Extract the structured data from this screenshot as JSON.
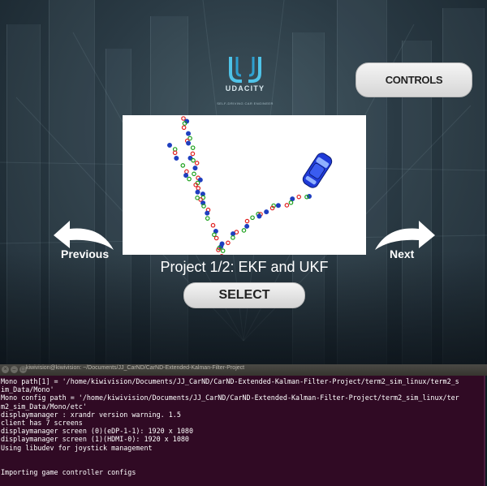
{
  "simulator": {
    "logo": {
      "wordmark": "UDACITY",
      "tagline": "SELF-DRIVING CAR ENGINEER",
      "icon": "udacity-u-logo"
    },
    "controls_label": "CONTROLS",
    "previous_label": "Previous",
    "next_label": "Next",
    "project_title": "Project 1/2: EKF and UKF",
    "select_label": "SELECT",
    "preview": {
      "icon": "car-icon",
      "marker_colors": {
        "lidar": "#e02020",
        "radar": "#1f3fbf",
        "estimate": "#1aa01a"
      },
      "car_color": "#1f3ad8"
    },
    "colors": {
      "button_bg": "#e6e6e6",
      "text_light": "#ffffff"
    }
  },
  "terminal": {
    "title": "kiwivision@kiwivision: ~/Documents/JJ_CarND/CarND-Extended-Kalman-Filter-Project",
    "lines": [
      "Mono path[1] = '/home/kiwivision/Documents/JJ_CarND/CarND-Extended-Kalman-Filter-Project/term2_sim_linux/term2_s",
      "im_Data/Mono'",
      "Mono config path = '/home/kiwivision/Documents/JJ_CarND/CarND-Extended-Kalman-Filter-Project/term2_sim_linux/ter",
      "m2_sim_Data/Mono/etc'",
      "displaymanager : xrandr version warning. 1.5",
      "client has 7 screens",
      "displaymanager screen (0)(eDP-1-1): 1920 x 1080",
      "displaymanager screen (1)(HDMI-0): 1920 x 1080",
      "Using libudev for joystick management",
      "",
      "",
      "Importing game controller configs"
    ],
    "colors": {
      "bg": "#300a24",
      "fg": "#ffffff"
    }
  }
}
